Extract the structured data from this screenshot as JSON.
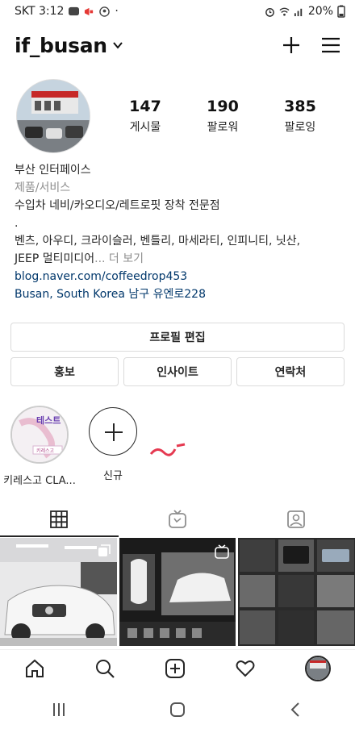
{
  "status_bar": {
    "carrier_time": "SKT 3:12",
    "dot": "·",
    "battery": "20%"
  },
  "top_bar": {
    "username": "if_busan"
  },
  "profile": {
    "stats": [
      {
        "value": "147",
        "label": "게시물"
      },
      {
        "value": "190",
        "label": "팔로워"
      },
      {
        "value": "385",
        "label": "팔로잉"
      }
    ]
  },
  "bio": {
    "name": "부산 인터페이스",
    "category": "제품/서비스",
    "line1": "수입차 네비/카오디오/레트로핏 장착 전문점",
    "line2": ".",
    "line3": "벤츠, 아우디, 크라이슬러, 벤틀리, 마세라티, 인피니티, 닛산,",
    "line4": "JEEP 멀티미디어",
    "more": "... 더 보기",
    "link": "blog.naver.com/coffeedrop453",
    "location": "Busan, South Korea 남구 유엔로228"
  },
  "buttons": {
    "edit_profile": "프로필 편집",
    "promote": "홍보",
    "insights": "인사이트",
    "contact": "연락처"
  },
  "highlights": [
    {
      "label": "키레스고 CLA..."
    },
    {
      "label": "신규"
    }
  ],
  "highlight_inner_text": {
    "top": "테스트",
    "bottom": "키레스고"
  }
}
